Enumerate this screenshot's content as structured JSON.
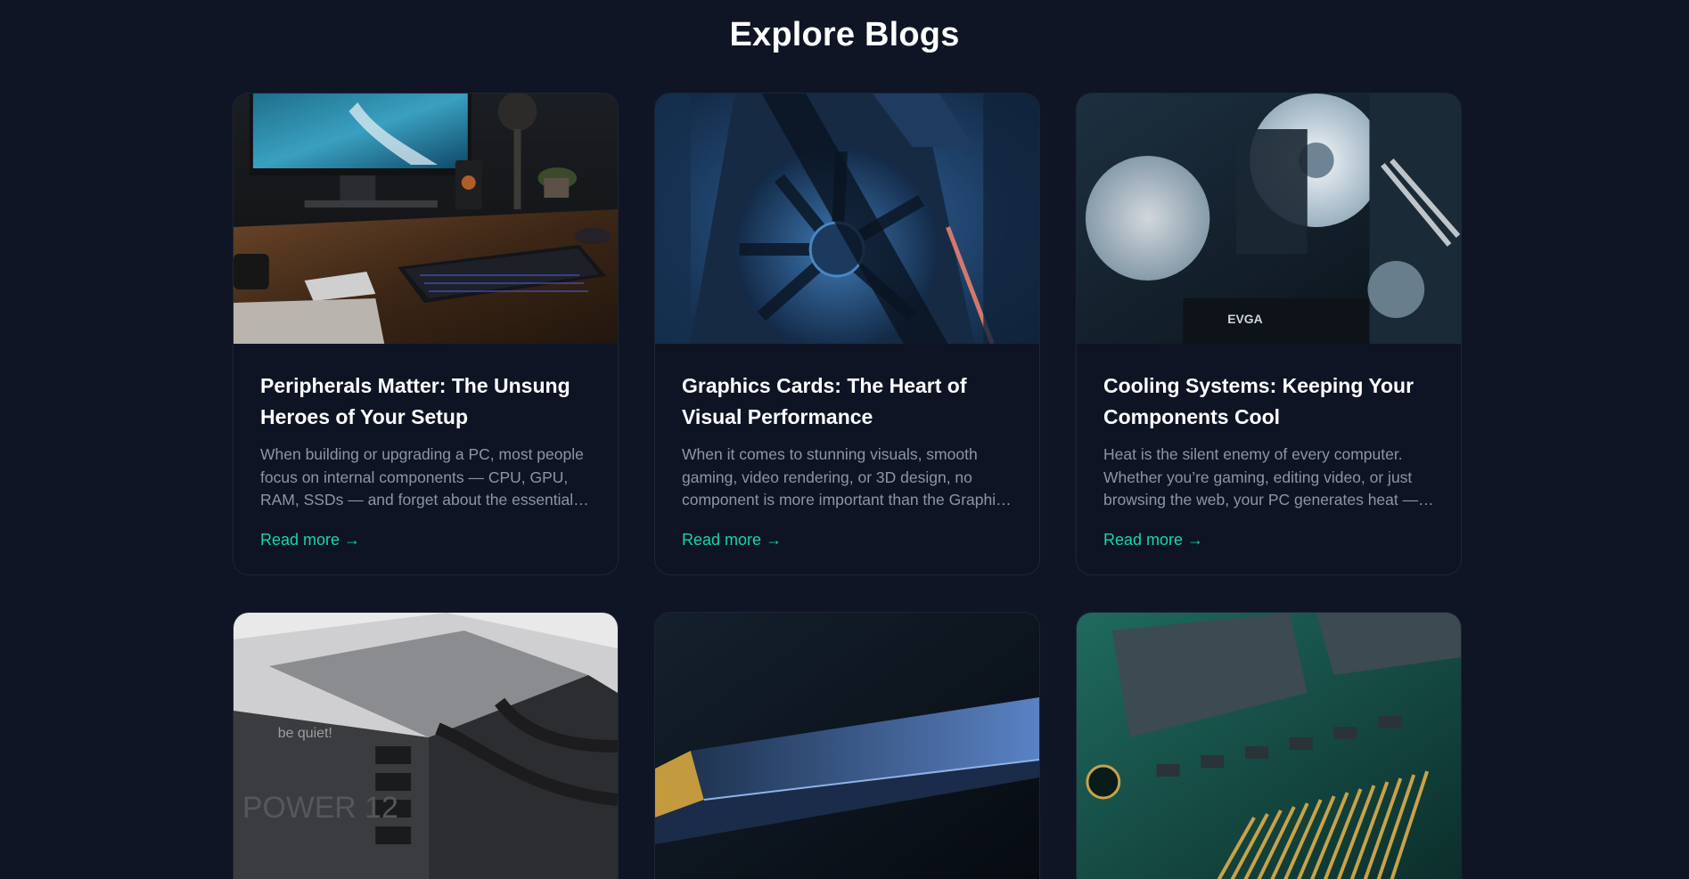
{
  "page": {
    "title": "Explore Blogs"
  },
  "colors": {
    "background": "#0f1524",
    "accent": "#16d6a6",
    "card_border": "#1d2537",
    "muted_text": "#8d95a5"
  },
  "cards": [
    {
      "title": "Peripherals Matter: The Unsung Heroes of Your Setup",
      "excerpt": "When building or upgrading a PC, most people focus on internal components — CPU, GPU, RAM, SSDs — and forget about the essential peripherals that shape your everyday experience.",
      "link": "Read more →"
    },
    {
      "title": "Graphics Cards: The Heart of Visual Performance",
      "excerpt": "When it comes to stunning visuals, smooth gaming, video rendering, or 3D design, no component is more important than the Graphics Processing Unit (GPU).",
      "link": "Read more →"
    },
    {
      "title": "Cooling Systems: Keeping Your Components Cool",
      "excerpt": "Heat is the silent enemy of every computer. Whether you’re gaming, editing video, or just browsing the web, your PC generates heat — and managing it is critical.",
      "link": "Read more →"
    }
  ],
  "partial_cards": [
    {
      "image": "psu"
    },
    {
      "image": "ssd"
    },
    {
      "image": "ram"
    }
  ]
}
